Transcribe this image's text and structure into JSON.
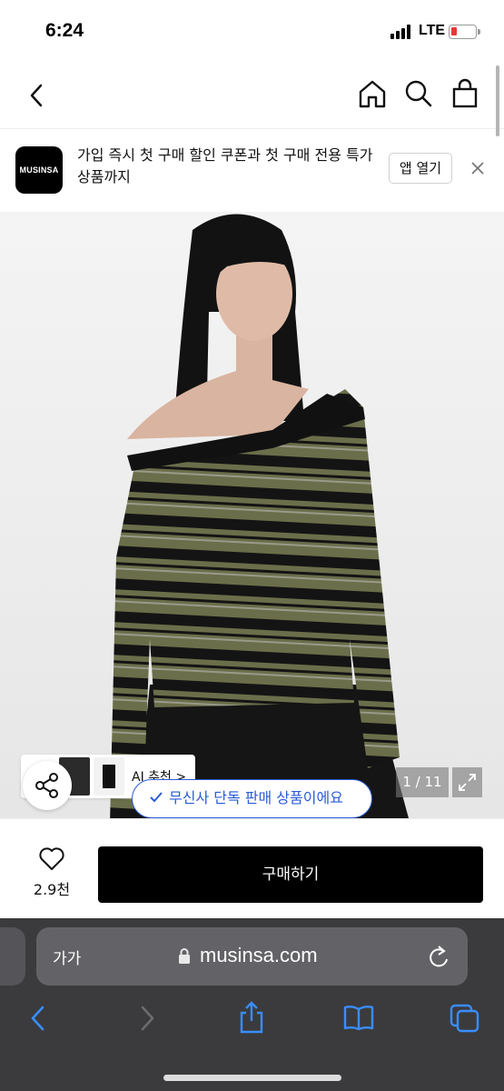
{
  "status_bar": {
    "time": "6:24",
    "network": "LTE",
    "battery_level": 0.15,
    "battery_color": "#e53935"
  },
  "nav": {
    "back_icon": "chevron-left-icon",
    "icons": [
      "home-icon",
      "search-icon",
      "shopping-bag-icon"
    ]
  },
  "app_banner": {
    "logo_text": "MUSINSA",
    "message": "가입 즉시 첫 구매 할인 쿠폰과 첫 구매 전용 특가 상품까지",
    "open_label": "앱 열기",
    "close_icon": "close-icon"
  },
  "product": {
    "image_description_icon": "product-photo",
    "ai_recommend_label": "AI 추천 >",
    "exclusive_badge": "무신사 단독 판매 상품이에요",
    "page_counter": "1 / 11",
    "accent_color": "#2a5bd7"
  },
  "bottom_bar": {
    "like_count": "2.9천",
    "buy_label": "구매하기"
  },
  "safari": {
    "text_size_label": "가가",
    "url": "musinsa.com"
  }
}
